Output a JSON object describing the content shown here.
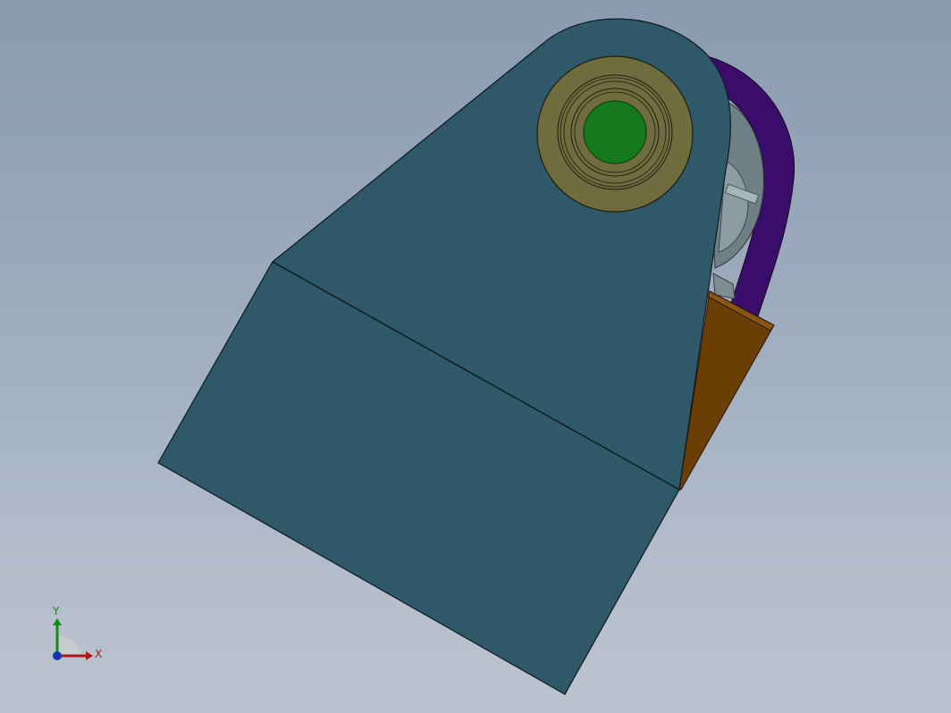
{
  "triad": {
    "x_label": "X",
    "y_label": "Y"
  },
  "colors": {
    "body_face": "#2f5868",
    "body_outline": "#0e1a20",
    "bracket": "#6b3e06",
    "bracket_edge": "#8a5416",
    "strap": "#3a0d6a",
    "bearing_ring": "#6f6c40",
    "shaft": "#157a1e",
    "motor_housing": "#6e8086",
    "x_axis": "#b01818",
    "y_axis": "#12891a",
    "z_axis": "#1833b0"
  },
  "icons": {
    "triad": "coordinate-triad-icon"
  }
}
